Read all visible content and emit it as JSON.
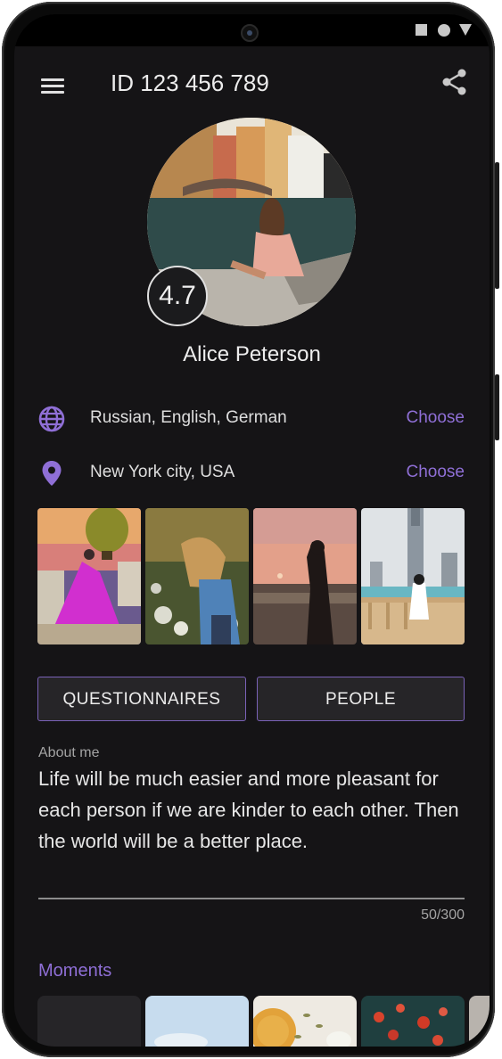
{
  "header": {
    "title": "ID 123 456 789"
  },
  "profile": {
    "rating": "4.7",
    "name": "Alice Peterson"
  },
  "languages": {
    "text": "Russian, English, German",
    "action": "Choose"
  },
  "location": {
    "text": "New York city, USA",
    "action": "Choose"
  },
  "tabs": {
    "questionnaires": "QUESTIONNAIRES",
    "people": "PEOPLE"
  },
  "about": {
    "label": "About me",
    "text": "Life will be much easier and more pleasant for each person if we are kinder to each other. Then the world will be a better place.",
    "counter": "50/300"
  },
  "moments": {
    "title": "Moments"
  },
  "colors": {
    "accent": "#8f6fd6",
    "background": "#151416"
  }
}
